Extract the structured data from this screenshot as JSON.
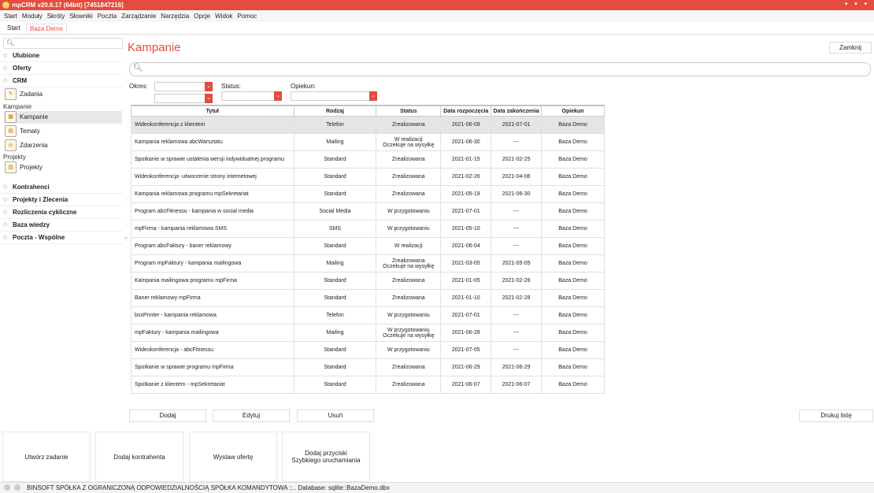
{
  "window": {
    "title": "mpCRM v20.6.17 (64bit) [7451847216]",
    "controls": "• • •"
  },
  "menu": [
    "Start",
    "Moduły",
    "Skróty",
    "Słowniki",
    "Poczta",
    "Zarządzanie",
    "Narzędzia",
    "Opcje",
    "Widok",
    "Pomoc"
  ],
  "tabs": {
    "start": "Start",
    "active": "Baza Demo"
  },
  "sidebar": {
    "sections_top": [
      "Ulubione",
      "Oferty",
      "CRM"
    ],
    "zadania": "Zadania",
    "kampanie_group": "Kampanie",
    "kampanie_items": [
      "Kampanie",
      "Tematy",
      "Zdarzenia"
    ],
    "projekty_group": "Projekty",
    "projekty_item": "Projekty",
    "sections_bottom": [
      "Kontrahenci",
      "Projekty i Zlecenia",
      "Rozliczenia cykliczne",
      "Baza wiedzy",
      "Poczta - Wspólne"
    ]
  },
  "main": {
    "title": "Kampanie",
    "close_label": "Zamknij",
    "filters": {
      "okres": "Okres:",
      "status": "Status:",
      "opiekun": "Opiekun:"
    },
    "columns": [
      "Tytuł",
      "Rodzaj",
      "Status",
      "Data rozpoczęcia",
      "Data zakończenia",
      "Opiekun"
    ],
    "rows": [
      [
        "Wideokonferencja z klientem",
        "Telefon",
        "Zrealizowana",
        "2021-06-09",
        "2021-07-01",
        "Baza Demo"
      ],
      [
        "Kampania reklamowa abcWarsztatu",
        "Mailing",
        "W realizacji\nOczekuje na wysyłkę",
        "2021-06-30",
        "---",
        "Baza Demo"
      ],
      [
        "Spotkanie w sprawie ustalenia wersji indywidualnej programu",
        "Standard",
        "Zrealizowana",
        "2021-01-15",
        "2021-02-25",
        "Baza Demo"
      ],
      [
        "Wideokonferencja -utworzenie strony internetowej",
        "Standard",
        "Zrealizowana",
        "2021-02-26",
        "2021-04-06",
        "Baza Demo"
      ],
      [
        "Kampania reklamowa programu mpSekretariat",
        "Standard",
        "Zrealizowana",
        "2021-05-19",
        "2021-06-30",
        "Baza Demo"
      ],
      [
        "Program abcFitnessu - kampania w social media",
        "Social Media",
        "W przygotowaniu",
        "2021-07-01",
        "---",
        "Baza Demo"
      ],
      [
        "mpFirma - kampania reklamowa SMS",
        "SMS",
        "W przygotowaniu",
        "2021-05-10",
        "---",
        "Baza Demo"
      ],
      [
        "Program abcFaktury - baner reklamowy",
        "Standard",
        "W realizacji",
        "2021-06-04",
        "---",
        "Baza Demo"
      ],
      [
        "Program mpFaktury - kampania mailingowa",
        "Mailing",
        "Zrealizowana\nOczekuje na wysyłkę",
        "2021-03-05",
        "2021-05-05",
        "Baza Demo"
      ],
      [
        "Kampania mailingowa programu mpFirma",
        "Standard",
        "Zrealizowana",
        "2021-01-05",
        "2021-02-28",
        "Baza Demo"
      ],
      [
        "Baner reklamowy mpFirma",
        "Standard",
        "Zrealizowana",
        "2021-01-10",
        "2021-02-28",
        "Baza Demo"
      ],
      [
        "bsxPrinter - kampania reklamowa",
        "Telefon",
        "W przygotowaniu",
        "2021-07-01",
        "---",
        "Baza Demo"
      ],
      [
        "mpFaktury - kampania mailingowa",
        "Mailing",
        "W przygotowaniu\nOczekuje na wysyłkę",
        "2021-06-28",
        "---",
        "Baza Demo"
      ],
      [
        "Wideokonferencja - abcFitnessu",
        "Standard",
        "W przygotowaniu",
        "2021-07-05",
        "---",
        "Baza Demo"
      ],
      [
        "Spotkanie w sprawie programu mpFirma",
        "Standard",
        "Zrealizowana",
        "2021-06-29",
        "2021-06-29",
        "Baza Demo"
      ],
      [
        "Spotkanie z klientem - mpSekretariat",
        "Standard",
        "Zrealizowana",
        "2021-06-07",
        "2021-06-07",
        "Baza Demo"
      ]
    ],
    "buttons": {
      "dodaj": "Dodaj",
      "edytuj": "Edytuj",
      "usun": "Usuń",
      "drukuj": "Drukuj listę"
    }
  },
  "quick": [
    "Utwórz zadanie",
    "Dodaj kontrahenta",
    "Wystaw ofertę",
    "Dodaj przyciski\nSzybkiego uruchamiania"
  ],
  "status": {
    "text": "BINSOFT SPÓŁKA Z OGRANICZONĄ ODPOWIEDZIALNOŚCIĄ SPÓŁKA KOMANDYTOWA ::.. Database: sqlite::BazaDemo.dbx"
  }
}
